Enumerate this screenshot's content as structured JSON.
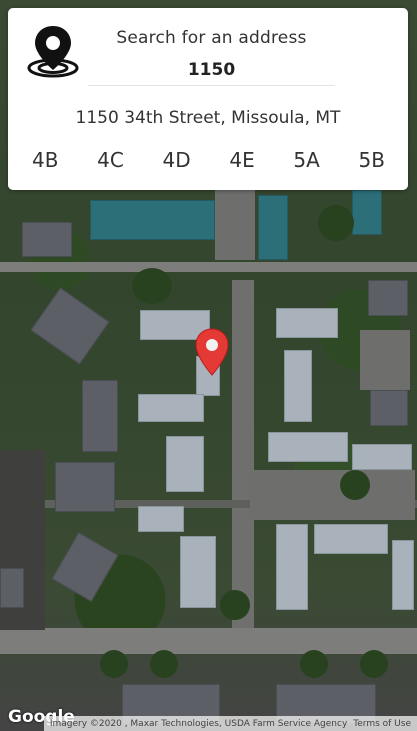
{
  "search": {
    "label": "Search for an address",
    "value": "1150"
  },
  "result": {
    "address": "1150 34th Street, Missoula, MT"
  },
  "units": [
    "4B",
    "4C",
    "4D",
    "4E",
    "5A",
    "5B"
  ],
  "map": {
    "logo": "Google",
    "attribution": "Imagery ©2020 , Maxar Technologies, USDA Farm Service Agency",
    "terms": "Terms of Use"
  },
  "colors": {
    "marker": "#e53935",
    "card": "#ffffff"
  },
  "icons": {
    "location": "map-pin-icon",
    "marker": "red-map-marker-icon"
  }
}
